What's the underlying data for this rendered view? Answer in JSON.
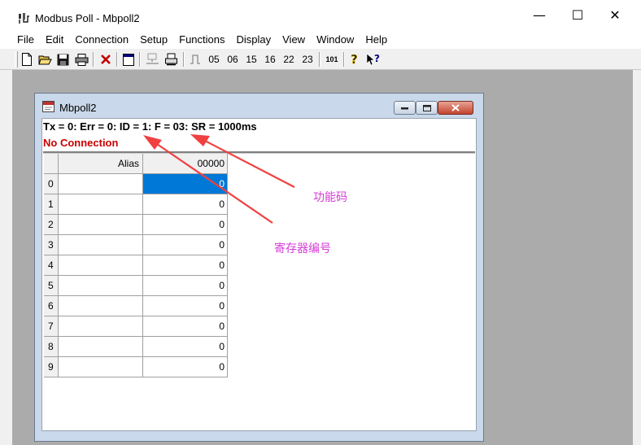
{
  "window": {
    "title": "Modbus Poll - Mbpoll2",
    "controls": {
      "minimize": "—",
      "maximize": "☐",
      "close": "✕"
    }
  },
  "menu": [
    "File",
    "Edit",
    "Connection",
    "Setup",
    "Functions",
    "Display",
    "View",
    "Window",
    "Help"
  ],
  "toolbar": {
    "function_codes": [
      "05",
      "06",
      "15",
      "16",
      "22",
      "23"
    ],
    "extra": "101",
    "icons": [
      "new-icon",
      "open-icon",
      "save-icon",
      "print-icon",
      "disconnect-icon",
      "window-icon",
      "connect-icon",
      "printer-tray-icon",
      "pulse-icon",
      "help-icon",
      "context-help-icon"
    ]
  },
  "child": {
    "title": "Mbpoll2",
    "status": "Tx = 0: Err = 0: ID = 1: F = 03: SR = 1000ms",
    "connection": "No Connection",
    "grid": {
      "headers": {
        "alias": "Alias",
        "value": "00000"
      },
      "rows": [
        {
          "index": "0",
          "alias": "",
          "value": "0"
        },
        {
          "index": "1",
          "alias": "",
          "value": "0"
        },
        {
          "index": "2",
          "alias": "",
          "value": "0"
        },
        {
          "index": "3",
          "alias": "",
          "value": "0"
        },
        {
          "index": "4",
          "alias": "",
          "value": "0"
        },
        {
          "index": "5",
          "alias": "",
          "value": "0"
        },
        {
          "index": "6",
          "alias": "",
          "value": "0"
        },
        {
          "index": "7",
          "alias": "",
          "value": "0"
        },
        {
          "index": "8",
          "alias": "",
          "value": "0"
        },
        {
          "index": "9",
          "alias": "",
          "value": "0"
        }
      ],
      "selected_row": 0
    }
  },
  "annotations": {
    "function_code": "功能码",
    "register_number": "寄存器编号",
    "color": "#d63cd6",
    "arrow_color": "#f04040"
  }
}
